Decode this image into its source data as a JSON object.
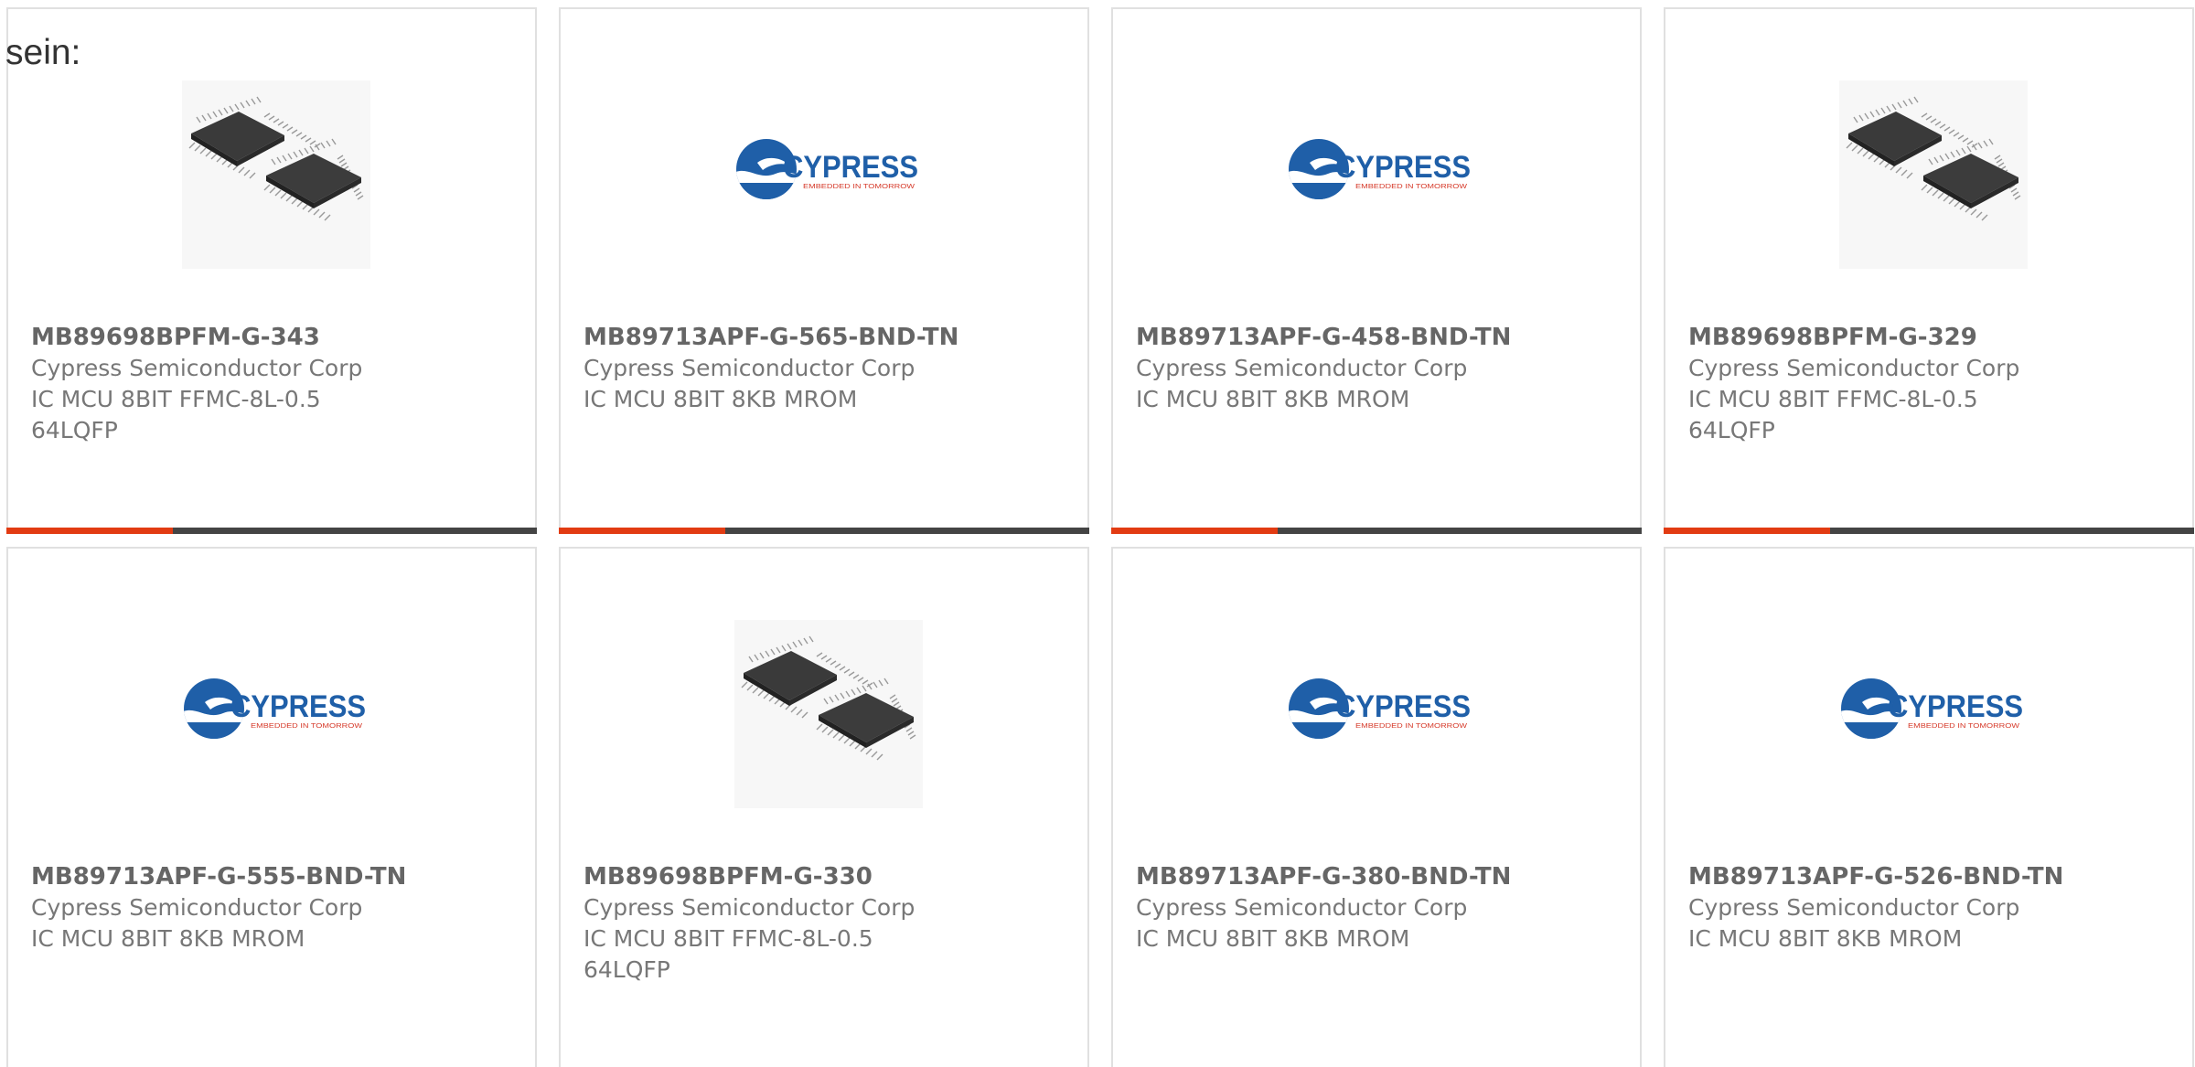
{
  "intro_text": "sein:",
  "colors": {
    "accent": "#e23b12",
    "bar": "#444444",
    "cypress_blue": "#1f5fa8",
    "cypress_red": "#d63a2a"
  },
  "logo_text": "CYPRESS",
  "logo_tagline": "EMBEDDED IN TOMORROW",
  "products": [
    {
      "part": "MB89698BPFM-G-343",
      "manufacturer": "Cypress Semiconductor Corp",
      "description": "IC MCU 8BIT FFMC-8L-0.5 64LQFP",
      "image": "chip"
    },
    {
      "part": "MB89713APF-G-565-BND-TN",
      "manufacturer": "Cypress Semiconductor Corp",
      "description": "IC MCU 8BIT 8KB MROM",
      "image": "cypress-logo"
    },
    {
      "part": "MB89713APF-G-458-BND-TN",
      "manufacturer": "Cypress Semiconductor Corp",
      "description": "IC MCU 8BIT 8KB MROM",
      "image": "cypress-logo"
    },
    {
      "part": "MB89698BPFM-G-329",
      "manufacturer": "Cypress Semiconductor Corp",
      "description": "IC MCU 8BIT FFMC-8L-0.5 64LQFP",
      "image": "chip"
    },
    {
      "part": "MB89713APF-G-555-BND-TN",
      "manufacturer": "Cypress Semiconductor Corp",
      "description": "IC MCU 8BIT 8KB MROM",
      "image": "cypress-logo"
    },
    {
      "part": "MB89698BPFM-G-330",
      "manufacturer": "Cypress Semiconductor Corp",
      "description": "IC MCU 8BIT FFMC-8L-0.5 64LQFP",
      "image": "chip"
    },
    {
      "part": "MB89713APF-G-380-BND-TN",
      "manufacturer": "Cypress Semiconductor Corp",
      "description": "IC MCU 8BIT 8KB MROM",
      "image": "cypress-logo"
    },
    {
      "part": "MB89713APF-G-526-BND-TN",
      "manufacturer": "Cypress Semiconductor Corp",
      "description": "IC MCU 8BIT 8KB MROM",
      "image": "cypress-logo"
    }
  ]
}
